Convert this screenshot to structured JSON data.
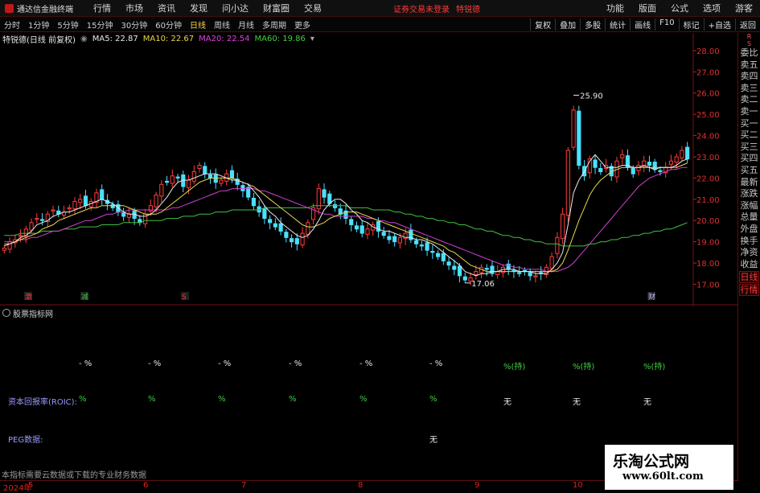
{
  "app": {
    "logo_text": "通达信金融终端",
    "menu": [
      "行情",
      "市场",
      "资讯",
      "发现",
      "问小达",
      "财富圈",
      "交易"
    ],
    "warning": "证券交易未登录",
    "warning_stock": "特锐德",
    "right_menu": [
      "功能",
      "版面",
      "公式",
      "选项",
      "游客"
    ]
  },
  "periods": [
    "分时",
    "1分钟",
    "5分钟",
    "15分钟",
    "30分钟",
    "60分钟",
    "日线",
    "周线",
    "月线",
    "多周期",
    "更多"
  ],
  "active_period": "日线",
  "toolbar": [
    "复权",
    "叠加",
    "多股",
    "统计",
    "画线",
    "F10",
    "标记",
    "+自选",
    "返回"
  ],
  "stock": {
    "title": "特锐德(日线 前复权)"
  },
  "ma_legend": [
    {
      "label": "MA5: 22.87",
      "color": "#e8e8e8"
    },
    {
      "label": "MA10: 22.67",
      "color": "#e8d84a"
    },
    {
      "label": "MA20: 22.54",
      "color": "#e040e0"
    },
    {
      "label": "MA60: 19.86",
      "color": "#40d040"
    }
  ],
  "right_panel": {
    "top": [
      "R",
      "S"
    ],
    "items": [
      "委比",
      "卖五",
      "卖四",
      "卖三",
      "卖二",
      "卖一",
      "买一",
      "买二",
      "买三",
      "买四",
      "买五",
      "最新",
      "涨跌",
      "涨幅",
      "总量",
      "外盘",
      "换手",
      "净资",
      "收益"
    ],
    "buttons": [
      "日线",
      "行情"
    ]
  },
  "indicator": {
    "name": "股票指标网",
    "row1_values": [
      "- %",
      "- %",
      "- %",
      "- %",
      "- %",
      "- %",
      "%(持)",
      "%(持)",
      "%(持)"
    ],
    "row2_label": "资本回报率(ROIC):",
    "row2_values": [
      "%",
      "%",
      "%",
      "%",
      "%",
      "%",
      "无",
      "无",
      "无"
    ],
    "row3_label": "PEG数据:",
    "row3_value": "无"
  },
  "status_msg": "本指标需要云数据或下载的专业财务数据",
  "time_axis": [
    {
      "label": "2024年",
      "x": 4
    },
    {
      "label": "5",
      "x": 35
    },
    {
      "label": "6",
      "x": 178
    },
    {
      "label": "7",
      "x": 300
    },
    {
      "label": "8",
      "x": 445
    },
    {
      "label": "9",
      "x": 590
    },
    {
      "label": "10",
      "x": 712
    }
  ],
  "watermark": {
    "line1": "乐淘公式网",
    "line2": "www.60lt.com"
  },
  "chart_data": {
    "type": "candlestick",
    "ylim": [
      16.6,
      28.3
    ],
    "y_ticks": [
      "28.00",
      "27.00",
      "26.00",
      "25.00",
      "24.00",
      "23.00",
      "22.00",
      "21.00",
      "20.00",
      "19.00",
      "18.00",
      "17.00"
    ],
    "high_label": "25.90",
    "low_label": "17.06",
    "markers": [
      {
        "text": "激",
        "color": "#e04040"
      },
      {
        "text": "减",
        "color": "#40c040"
      },
      {
        "text": "S",
        "color": "#e04040"
      },
      {
        "text": "财",
        "color": "#c0c0ff"
      }
    ],
    "closes": [
      18.7,
      19.0,
      19.1,
      19.3,
      19.6,
      19.9,
      20.1,
      20.0,
      20.3,
      20.5,
      20.3,
      20.4,
      20.6,
      20.9,
      21.0,
      20.7,
      20.9,
      21.3,
      21.0,
      20.8,
      20.6,
      20.4,
      20.2,
      20.3,
      20.1,
      19.9,
      20.3,
      20.7,
      21.2,
      21.7,
      21.8,
      22.1,
      22.0,
      21.6,
      21.9,
      22.3,
      22.6,
      22.2,
      22.0,
      21.8,
      21.9,
      22.2,
      22.0,
      21.7,
      21.4,
      21.1,
      20.7,
      20.4,
      20.1,
      19.9,
      19.7,
      19.5,
      19.2,
      19.0,
      18.9,
      19.4,
      19.9,
      20.6,
      21.5,
      21.1,
      20.8,
      20.6,
      20.3,
      20.1,
      19.8,
      19.6,
      19.4,
      19.6,
      19.8,
      19.5,
      19.3,
      19.1,
      19.0,
      19.2,
      19.4,
      19.1,
      18.9,
      18.8,
      18.6,
      18.5,
      18.3,
      18.1,
      17.9,
      17.7,
      17.4,
      17.2,
      17.3,
      17.6,
      17.8,
      17.7,
      17.5,
      17.6,
      17.8,
      17.7,
      17.6,
      17.5,
      17.6,
      17.4,
      17.4,
      17.5,
      17.8,
      18.3,
      19.2,
      20.3,
      23.3,
      25.2,
      22.6,
      22.1,
      22.9,
      22.5,
      22.3,
      22.6,
      22.1,
      22.8,
      23.1,
      22.5,
      22.2,
      22.6,
      22.8,
      22.6,
      22.4,
      22.3,
      22.5,
      22.8,
      23.0,
      23.3,
      22.9
    ],
    "ma5": [
      18.8,
      18.9,
      19.0,
      19.2,
      19.3,
      19.5,
      19.8,
      19.9,
      20.0,
      20.2,
      20.3,
      20.4,
      20.4,
      20.5,
      20.6,
      20.7,
      20.8,
      20.9,
      21.0,
      20.9,
      20.8,
      20.6,
      20.4,
      20.3,
      20.3,
      20.2,
      20.2,
      20.3,
      20.5,
      20.8,
      21.1,
      21.5,
      21.8,
      21.9,
      21.9,
      22.0,
      22.1,
      22.2,
      22.2,
      22.2,
      22.1,
      22.0,
      21.9,
      21.9,
      21.8,
      21.7,
      21.4,
      21.1,
      20.7,
      20.4,
      20.2,
      19.9,
      19.7,
      19.5,
      19.3,
      19.2,
      19.3,
      19.6,
      20.0,
      20.5,
      20.8,
      21.0,
      21.0,
      20.8,
      20.5,
      20.3,
      20.0,
      19.9,
      19.7,
      19.6,
      19.5,
      19.5,
      19.4,
      19.3,
      19.2,
      19.2,
      19.1,
      19.1,
      19.0,
      18.9,
      18.7,
      18.5,
      18.3,
      18.1,
      17.9,
      17.6,
      17.5,
      17.4,
      17.5,
      17.5,
      17.6,
      17.6,
      17.7,
      17.7,
      17.7,
      17.6,
      17.6,
      17.6,
      17.5,
      17.5,
      17.5,
      17.7,
      18.0,
      18.5,
      19.8,
      21.3,
      21.9,
      22.3,
      22.8,
      23.1,
      22.8,
      22.5,
      22.5,
      22.5,
      22.6,
      22.6,
      22.5,
      22.5,
      22.6,
      22.5,
      22.4,
      22.5,
      22.5,
      22.5,
      22.6,
      22.8,
      22.9
    ],
    "ma10": [
      18.9,
      18.9,
      19.0,
      19.1,
      19.2,
      19.3,
      19.4,
      19.6,
      19.7,
      19.8,
      20.0,
      20.1,
      20.2,
      20.3,
      20.4,
      20.5,
      20.6,
      20.6,
      20.7,
      20.7,
      20.7,
      20.7,
      20.7,
      20.6,
      20.5,
      20.4,
      20.3,
      20.3,
      20.3,
      20.4,
      20.6,
      20.8,
      21.0,
      21.2,
      21.4,
      21.6,
      21.8,
      21.9,
      22.0,
      22.0,
      22.0,
      22.0,
      22.0,
      21.9,
      21.8,
      21.7,
      21.6,
      21.4,
      21.2,
      21.0,
      20.8,
      20.6,
      20.4,
      20.2,
      20.0,
      19.8,
      19.7,
      19.7,
      19.8,
      19.9,
      20.1,
      20.2,
      20.3,
      20.4,
      20.4,
      20.4,
      20.3,
      20.2,
      20.1,
      20.0,
      19.9,
      19.8,
      19.7,
      19.6,
      19.5,
      19.4,
      19.3,
      19.2,
      19.1,
      19.0,
      18.9,
      18.8,
      18.6,
      18.5,
      18.3,
      18.1,
      17.9,
      17.8,
      17.7,
      17.6,
      17.6,
      17.6,
      17.6,
      17.6,
      17.6,
      17.6,
      17.6,
      17.6,
      17.6,
      17.6,
      17.6,
      17.6,
      17.7,
      18.0,
      18.6,
      19.3,
      20.0,
      20.6,
      21.2,
      21.6,
      21.9,
      22.1,
      22.3,
      22.4,
      22.5,
      22.5,
      22.5,
      22.5,
      22.5,
      22.5,
      22.5,
      22.5,
      22.5,
      22.5,
      22.5,
      22.6,
      22.7
    ],
    "ma20": [
      19.0,
      19.0,
      19.0,
      19.1,
      19.1,
      19.2,
      19.2,
      19.3,
      19.4,
      19.5,
      19.5,
      19.6,
      19.7,
      19.8,
      19.9,
      20.0,
      20.0,
      20.1,
      20.2,
      20.3,
      20.3,
      20.4,
      20.4,
      20.5,
      20.5,
      20.5,
      20.5,
      20.5,
      20.5,
      20.5,
      20.5,
      20.6,
      20.6,
      20.7,
      20.8,
      20.9,
      21.0,
      21.1,
      21.2,
      21.3,
      21.4,
      21.4,
      21.5,
      21.5,
      21.5,
      21.5,
      21.5,
      21.4,
      21.4,
      21.3,
      21.2,
      21.1,
      21.0,
      20.9,
      20.8,
      20.7,
      20.6,
      20.5,
      20.4,
      20.3,
      20.3,
      20.2,
      20.2,
      20.2,
      20.2,
      20.2,
      20.2,
      20.1,
      20.1,
      20.0,
      20.0,
      19.9,
      19.9,
      19.8,
      19.7,
      19.6,
      19.5,
      19.4,
      19.3,
      19.2,
      19.1,
      19.0,
      18.9,
      18.8,
      18.7,
      18.6,
      18.5,
      18.4,
      18.3,
      18.2,
      18.1,
      18.0,
      17.9,
      17.9,
      17.8,
      17.8,
      17.7,
      17.7,
      17.7,
      17.7,
      17.6,
      17.6,
      17.6,
      17.7,
      17.8,
      18.0,
      18.3,
      18.6,
      18.9,
      19.2,
      19.5,
      19.8,
      20.1,
      20.4,
      20.7,
      21.0,
      21.3,
      21.6,
      21.8,
      22.0,
      22.1,
      22.2,
      22.3,
      22.4,
      22.4,
      22.5,
      22.5
    ],
    "ma60": [
      19.3,
      19.3,
      19.3,
      19.4,
      19.4,
      19.4,
      19.4,
      19.5,
      19.5,
      19.5,
      19.5,
      19.6,
      19.6,
      19.6,
      19.7,
      19.7,
      19.7,
      19.7,
      19.8,
      19.8,
      19.8,
      19.8,
      19.9,
      19.9,
      19.9,
      19.9,
      20.0,
      20.0,
      20.0,
      20.0,
      20.1,
      20.1,
      20.1,
      20.2,
      20.2,
      20.2,
      20.3,
      20.3,
      20.3,
      20.4,
      20.4,
      20.4,
      20.5,
      20.5,
      20.5,
      20.5,
      20.5,
      20.5,
      20.6,
      20.6,
      20.6,
      20.6,
      20.6,
      20.6,
      20.6,
      20.6,
      20.6,
      20.7,
      20.7,
      20.7,
      20.7,
      20.7,
      20.7,
      20.7,
      20.6,
      20.6,
      20.6,
      20.6,
      20.5,
      20.5,
      20.5,
      20.5,
      20.4,
      20.4,
      20.3,
      20.3,
      20.2,
      20.2,
      20.1,
      20.1,
      20.0,
      20.0,
      19.9,
      19.9,
      19.8,
      19.8,
      19.7,
      19.6,
      19.6,
      19.5,
      19.5,
      19.4,
      19.3,
      19.3,
      19.2,
      19.2,
      19.1,
      19.1,
      19.0,
      19.0,
      18.9,
      18.9,
      18.9,
      18.8,
      18.8,
      18.8,
      18.8,
      18.8,
      18.9,
      18.9,
      19.0,
      19.0,
      19.1,
      19.1,
      19.2,
      19.2,
      19.3,
      19.3,
      19.4,
      19.4,
      19.5,
      19.5,
      19.6,
      19.6,
      19.7,
      19.8,
      19.9
    ]
  }
}
